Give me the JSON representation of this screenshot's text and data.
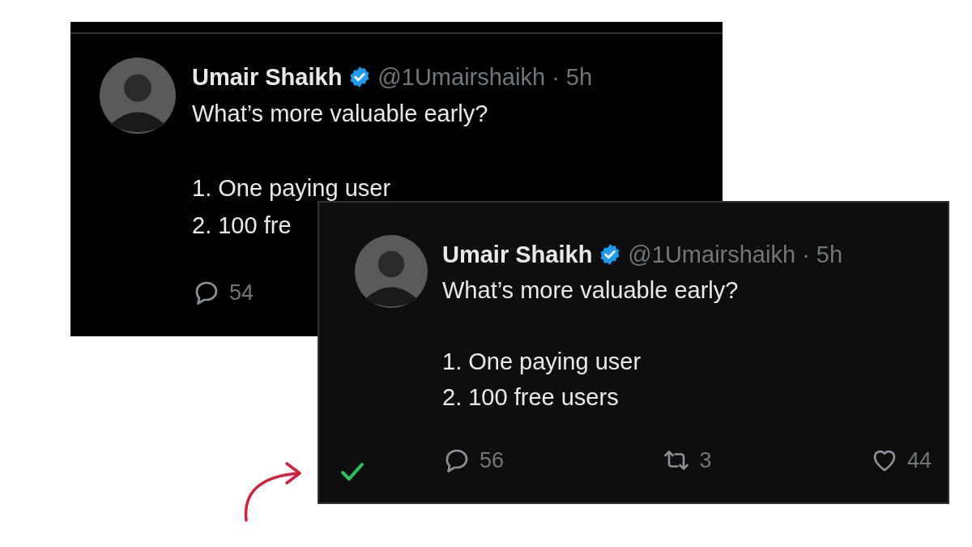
{
  "tweets": [
    {
      "author": "Umair Shaikh",
      "verified": true,
      "meta": "@1Umairshaikh · 5h",
      "lines": [
        "What’s more valuable early?",
        "1. One paying user",
        "2. 100 fre"
      ],
      "approved": false,
      "actions": [
        {
          "kind": "reply",
          "count": "54"
        }
      ]
    },
    {
      "author": "Umair Shaikh",
      "verified": true,
      "meta": "@1Umairshaikh · 5h",
      "lines": [
        "What’s more valuable early?",
        "1. One paying user",
        "2. 100 free users"
      ],
      "approved": true,
      "actions": [
        {
          "kind": "reply",
          "count": "56"
        },
        {
          "kind": "retweet",
          "count": "3"
        },
        {
          "kind": "like",
          "count": "44"
        }
      ]
    }
  ]
}
